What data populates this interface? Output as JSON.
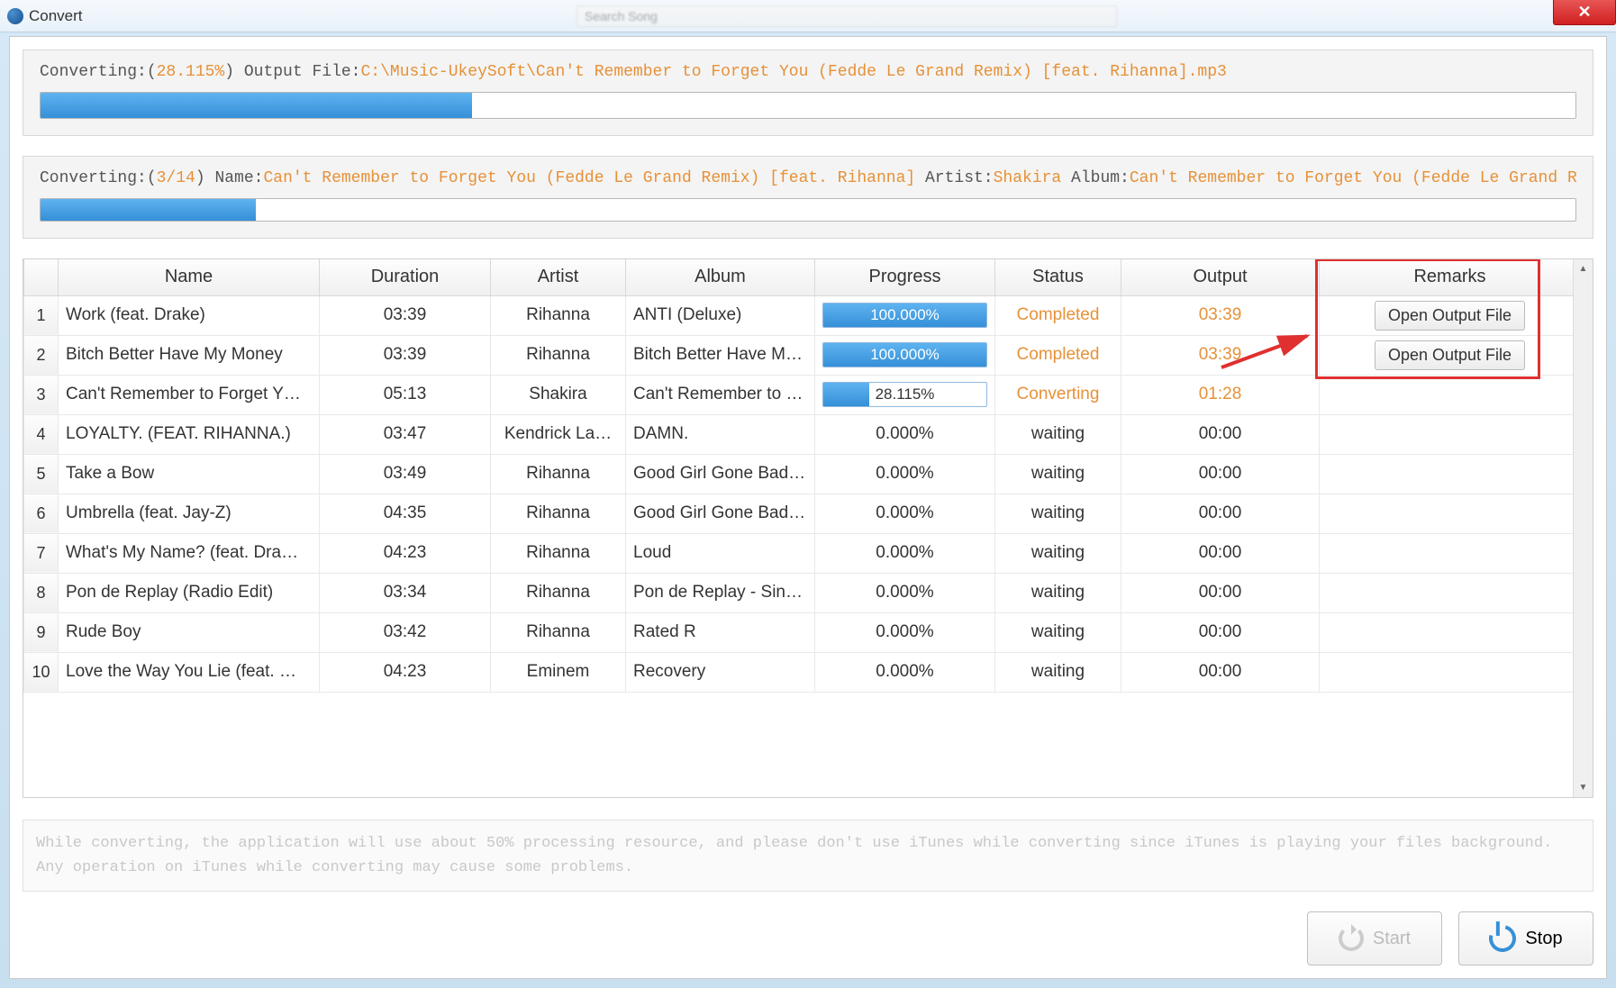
{
  "window": {
    "title": "Convert",
    "search_placeholder": "Search Song"
  },
  "top_panel": {
    "label_converting": "Converting:(",
    "percent": "28.115%",
    "label_output": ") Output File:",
    "filepath": "C:\\Music-UkeySoft\\Can't Remember to Forget You (Fedde Le Grand Remix) [feat. Rihanna].mp3",
    "progress_pct": 28.1
  },
  "mid_panel": {
    "label_converting": "Converting:(",
    "count": "3/14",
    "label_name": ") Name:",
    "name": "Can't Remember to Forget You (Fedde Le Grand Remix) [feat. Rihanna]",
    "label_artist": " Artist:",
    "artist": "Shakira",
    "label_album": " Album:",
    "album": "Can't Remember to Forget You (Fedde Le Grand Remix) [feat. Rihanna] - Single",
    "progress_pct": 14
  },
  "columns": {
    "name": "Name",
    "duration": "Duration",
    "artist": "Artist",
    "album": "Album",
    "progress": "Progress",
    "status": "Status",
    "output": "Output",
    "remarks": "Remarks"
  },
  "rows": [
    {
      "idx": "1",
      "name": "Work (feat. Drake)",
      "dur": "03:39",
      "artist": "Rihanna",
      "album": "ANTI (Deluxe)",
      "pct": "100.000%",
      "pctv": 100,
      "status": "Completed",
      "status_cls": "completed",
      "output": "03:39",
      "out_active": true,
      "remarks": "Open Output File"
    },
    {
      "idx": "2",
      "name": "Bitch Better Have My Money",
      "dur": "03:39",
      "artist": "Rihanna",
      "album": "Bitch Better Have M…",
      "pct": "100.000%",
      "pctv": 100,
      "status": "Completed",
      "status_cls": "completed",
      "output": "03:39",
      "out_active": true,
      "remarks": "Open Output File"
    },
    {
      "idx": "3",
      "name": "Can't Remember to Forget Y…",
      "dur": "05:13",
      "artist": "Shakira",
      "album": "Can't Remember to …",
      "pct": "28.115%",
      "pctv": 28,
      "status": "Converting",
      "status_cls": "converting",
      "output": "01:28",
      "out_active": true,
      "remarks": ""
    },
    {
      "idx": "4",
      "name": "LOYALTY. (FEAT. RIHANNA.)",
      "dur": "03:47",
      "artist": "Kendrick La…",
      "album": "DAMN.",
      "pct": "0.000%",
      "pctv": 0,
      "status": "waiting",
      "status_cls": "waiting",
      "output": "00:00",
      "out_active": false,
      "remarks": ""
    },
    {
      "idx": "5",
      "name": "Take a Bow",
      "dur": "03:49",
      "artist": "Rihanna",
      "album": "Good Girl Gone Bad…",
      "pct": "0.000%",
      "pctv": 0,
      "status": "waiting",
      "status_cls": "waiting",
      "output": "00:00",
      "out_active": false,
      "remarks": ""
    },
    {
      "idx": "6",
      "name": "Umbrella (feat. Jay-Z)",
      "dur": "04:35",
      "artist": "Rihanna",
      "album": "Good Girl Gone Bad…",
      "pct": "0.000%",
      "pctv": 0,
      "status": "waiting",
      "status_cls": "waiting",
      "output": "00:00",
      "out_active": false,
      "remarks": ""
    },
    {
      "idx": "7",
      "name": "What's My Name? (feat. Dra…",
      "dur": "04:23",
      "artist": "Rihanna",
      "album": "Loud",
      "pct": "0.000%",
      "pctv": 0,
      "status": "waiting",
      "status_cls": "waiting",
      "output": "00:00",
      "out_active": false,
      "remarks": ""
    },
    {
      "idx": "8",
      "name": "Pon de Replay (Radio Edit)",
      "dur": "03:34",
      "artist": "Rihanna",
      "album": "Pon de Replay - Sin…",
      "pct": "0.000%",
      "pctv": 0,
      "status": "waiting",
      "status_cls": "waiting",
      "output": "00:00",
      "out_active": false,
      "remarks": ""
    },
    {
      "idx": "9",
      "name": "Rude Boy",
      "dur": "03:42",
      "artist": "Rihanna",
      "album": "Rated R",
      "pct": "0.000%",
      "pctv": 0,
      "status": "waiting",
      "status_cls": "waiting",
      "output": "00:00",
      "out_active": false,
      "remarks": ""
    },
    {
      "idx": "10",
      "name": "Love the Way You Lie (feat. …",
      "dur": "04:23",
      "artist": "Eminem",
      "album": "Recovery",
      "pct": "0.000%",
      "pctv": 0,
      "status": "waiting",
      "status_cls": "waiting",
      "output": "00:00",
      "out_active": false,
      "remarks": ""
    }
  ],
  "footer_note": "While converting, the application will use about 50% processing resource, and please don't use iTunes while converting since iTunes is playing your files background. Any operation on iTunes while converting may cause some problems.",
  "buttons": {
    "start": "Start",
    "stop": "Stop"
  }
}
